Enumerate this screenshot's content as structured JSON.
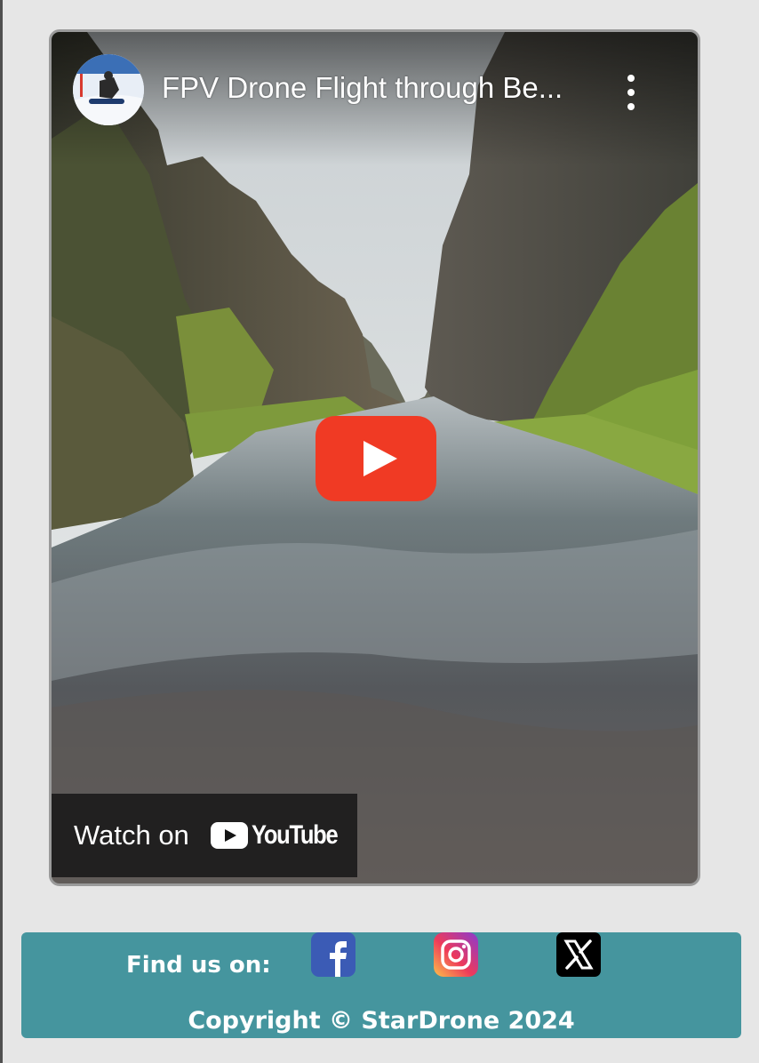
{
  "video": {
    "title": "FPV Drone Flight through Be...",
    "watch_on_label": "Watch on",
    "youtube_wordmark": "YouTube",
    "play_icon": "play-icon",
    "more_icon": "more-vertical-icon",
    "accent_color": "#f03a24"
  },
  "footer": {
    "find_us_label": "Find us on:",
    "social": [
      {
        "name": "Facebook",
        "icon": "facebook-icon"
      },
      {
        "name": "Instagram",
        "icon": "instagram-icon"
      },
      {
        "name": "X",
        "icon": "x-icon"
      }
    ],
    "copyright": "Copyright © StarDrone 2024",
    "background_color": "#45959e"
  }
}
